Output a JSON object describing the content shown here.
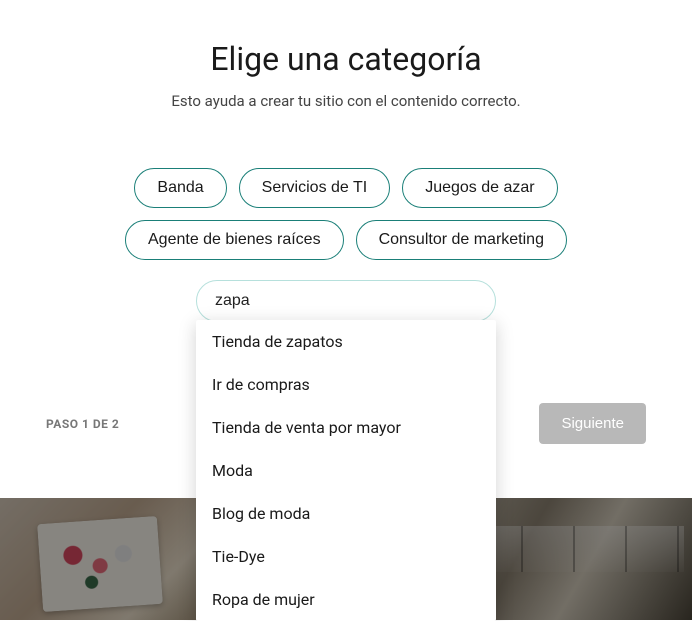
{
  "title": "Elige una categoría",
  "subtitle": "Esto ayuda a crear tu sitio con el contenido correcto.",
  "category_pills": [
    "Banda",
    "Servicios de TI",
    "Juegos de azar",
    "Agente de bienes raíces",
    "Consultor de marketing"
  ],
  "search": {
    "value": "zapa"
  },
  "suggestions": [
    "Tienda de zapatos",
    "Ir de compras",
    "Tienda de venta por mayor",
    "Moda",
    "Blog de moda",
    "Tie-Dye",
    "Ropa de mujer"
  ],
  "footer": {
    "step_label": "PASO 1 DE 2",
    "next_label": "Siguiente"
  }
}
